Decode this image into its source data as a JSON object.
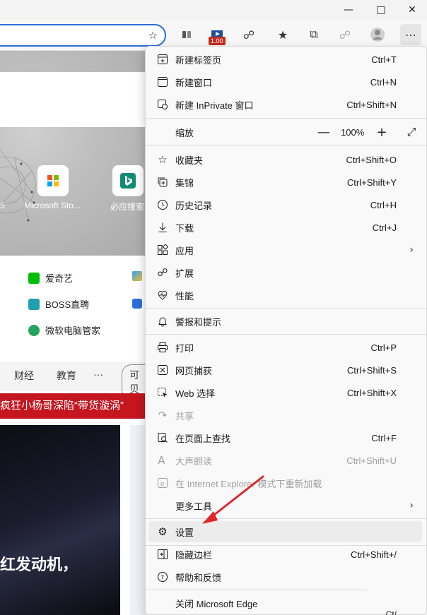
{
  "window": {
    "minimize_icon": "minimize-icon",
    "maximize_icon": "maximize-icon",
    "close_icon": "close-icon"
  },
  "toolbar": {
    "extension_badge": "1.00",
    "icons": [
      "add-favorite-icon",
      "app-icon",
      "extension-icon",
      "puzzle-icon",
      "favorites-icon",
      "collections-icon",
      "browser-essentials-icon",
      "profile-icon",
      "more-icon"
    ]
  },
  "page": {
    "tiles": [
      {
        "label": "5"
      },
      {
        "label": "Microsoft Sto..."
      },
      {
        "label": "必应搜索"
      }
    ],
    "links": [
      {
        "label": "爱奇艺"
      },
      {
        "label": "BOSS直聘"
      },
      {
        "label": "微软电脑管家"
      }
    ],
    "tabs": [
      "财经",
      "教育",
      "···",
      "可贝"
    ],
    "news_banner": "疯狂小杨哥深陷“带货漩涡”",
    "headline": "红发动机，"
  },
  "menu": {
    "items": [
      {
        "label": "新建标签页",
        "shortcut": "Ctrl+T",
        "icon": "new-tab-icon"
      },
      {
        "label": "新建窗口",
        "shortcut": "Ctrl+N",
        "icon": "new-window-icon"
      },
      {
        "label": "新建 InPrivate 窗口",
        "shortcut": "Ctrl+Shift+N",
        "icon": "inprivate-icon"
      },
      {
        "label": "缩放",
        "zoom_value": "100%",
        "icon": "zoom-icon"
      },
      {
        "label": "收藏夹",
        "shortcut": "Ctrl+Shift+O",
        "icon": "favorites-icon"
      },
      {
        "label": "集锦",
        "shortcut": "Ctrl+Shift+Y",
        "icon": "collections-icon"
      },
      {
        "label": "历史记录",
        "shortcut": "Ctrl+H",
        "icon": "history-icon"
      },
      {
        "label": "下载",
        "shortcut": "Ctrl+J",
        "icon": "download-icon"
      },
      {
        "label": "应用",
        "icon": "apps-icon"
      },
      {
        "label": "扩展",
        "icon": "extensions-icon"
      },
      {
        "label": "性能",
        "icon": "performance-icon"
      },
      {
        "label": "警报和提示",
        "icon": "bell-icon"
      },
      {
        "label": "打印",
        "shortcut": "Ctrl+P",
        "icon": "print-icon"
      },
      {
        "label": "网页捕获",
        "shortcut": "Ctrl+Shift+S",
        "icon": "web-capture-icon"
      },
      {
        "label": "Web 选择",
        "shortcut": "Ctrl+Shift+X",
        "icon": "web-select-icon"
      },
      {
        "label": "共享",
        "icon": "share-icon"
      },
      {
        "label": "在页面上查找",
        "shortcut": "Ctrl+F",
        "icon": "find-icon"
      },
      {
        "label": "大声朗读",
        "shortcut": "Ctrl+Shift+U",
        "icon": "read-aloud-icon"
      },
      {
        "label": "在 Internet Explorer 模式下重新加载",
        "icon": "ie-mode-icon"
      },
      {
        "label": "更多工具",
        "icon": ""
      },
      {
        "label": "设置",
        "icon": "settings-icon"
      },
      {
        "label": "隐藏边栏",
        "shortcut": "Ctrl+Shift+/",
        "icon": "sidebar-icon"
      },
      {
        "label": "帮助和反馈",
        "icon": "help-icon"
      },
      {
        "label": "关闭 Microsoft Edge",
        "icon": ""
      }
    ],
    "clipped_shortcut": "Ct/"
  },
  "colors": {
    "accent": "#2c6fd6",
    "annotation_arrow": "#e0262a",
    "news_red": "#c5151f"
  }
}
